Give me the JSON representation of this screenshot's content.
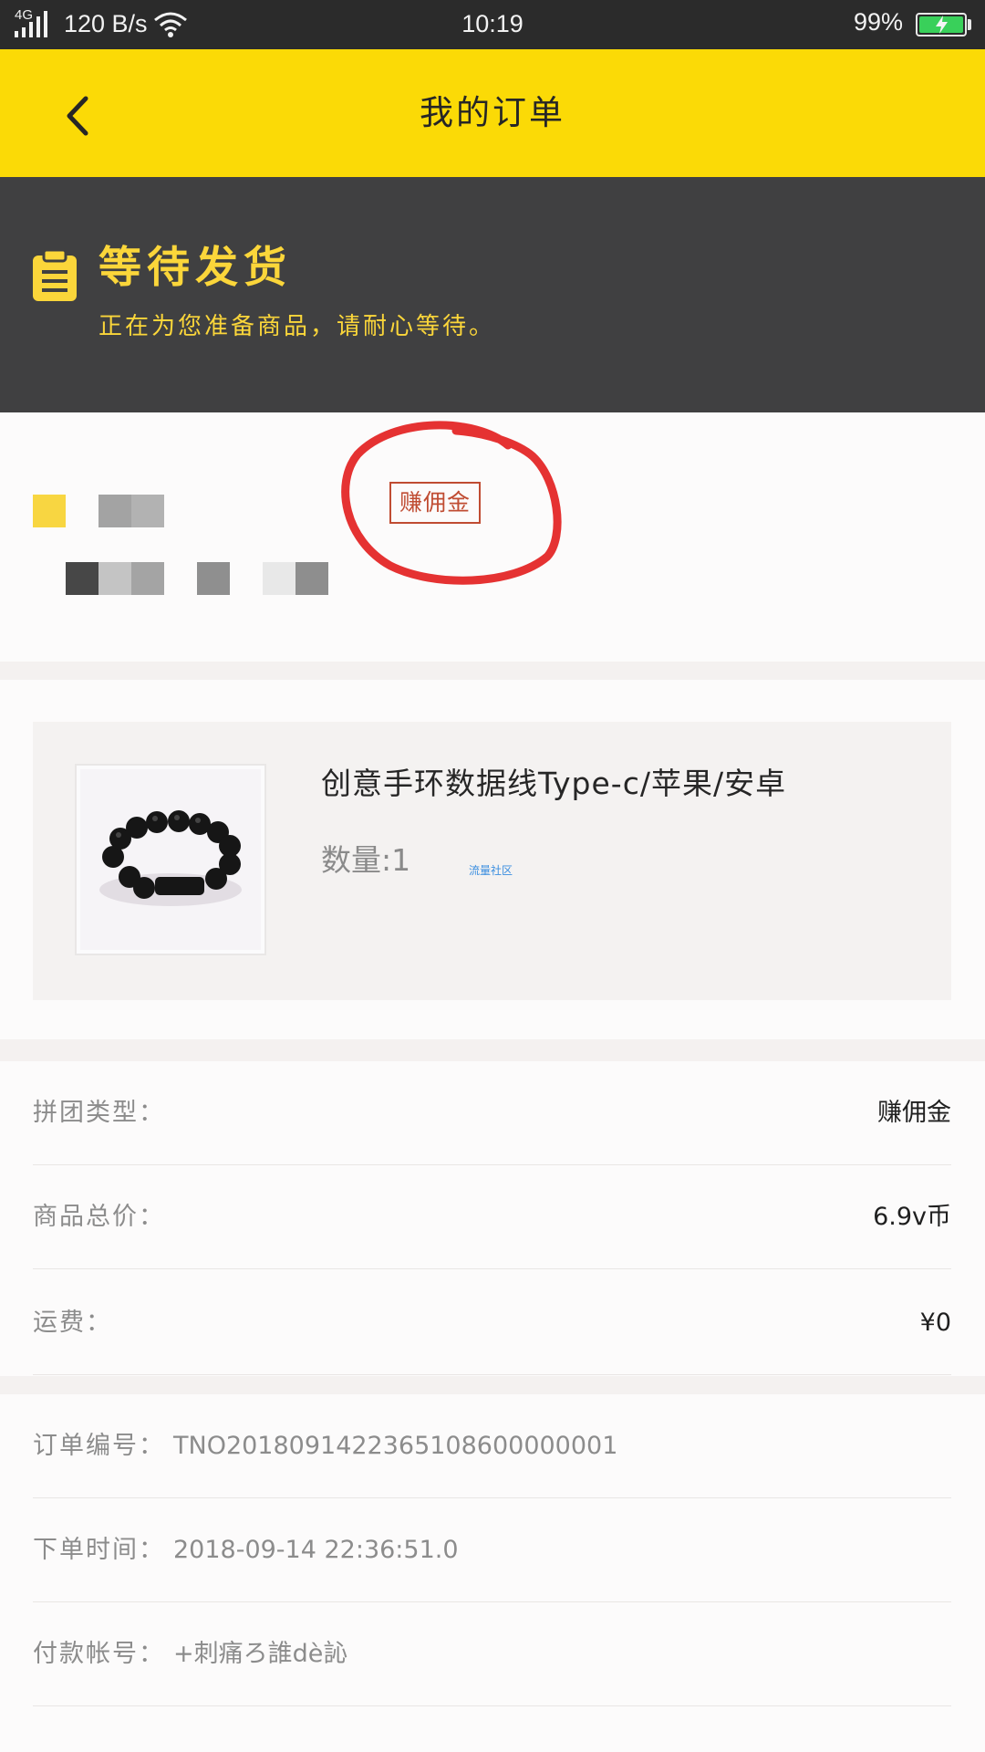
{
  "status_bar": {
    "network_type": "4G",
    "speed": "120 B/s",
    "time": "10:19",
    "battery_pct": "99%",
    "battery_level": 0.99,
    "battery_color": "#39d05a"
  },
  "header": {
    "title": "我的订单",
    "back_icon": "chevron-left-icon",
    "background": "#fbda06"
  },
  "order_status": {
    "icon": "clipboard-icon",
    "title": "等待发货",
    "subtitle": "正在为您准备商品，请耐心等待。",
    "accent_color": "#fbd63a",
    "background": "#404041"
  },
  "address": {
    "redacted": true,
    "tag": "赚佣金"
  },
  "product": {
    "name": "创意手环数据线Type-c/苹果/安卓",
    "quantity_label": "数量:1",
    "watermark": "流量社区"
  },
  "details": [
    {
      "label": "拼团类型：",
      "value": "赚佣金"
    },
    {
      "label": "商品总价：",
      "value": "6.9v币"
    },
    {
      "label": "运费：",
      "value": "¥0"
    }
  ],
  "order_info": [
    {
      "label": "订单编号：",
      "value": "TNO2018091422365108600000001"
    },
    {
      "label": "下单时间：",
      "value": "2018-09-14 22:36:51.0"
    },
    {
      "label": "付款帐号：",
      "value": "+刺痛ろ誰dè訫"
    }
  ]
}
